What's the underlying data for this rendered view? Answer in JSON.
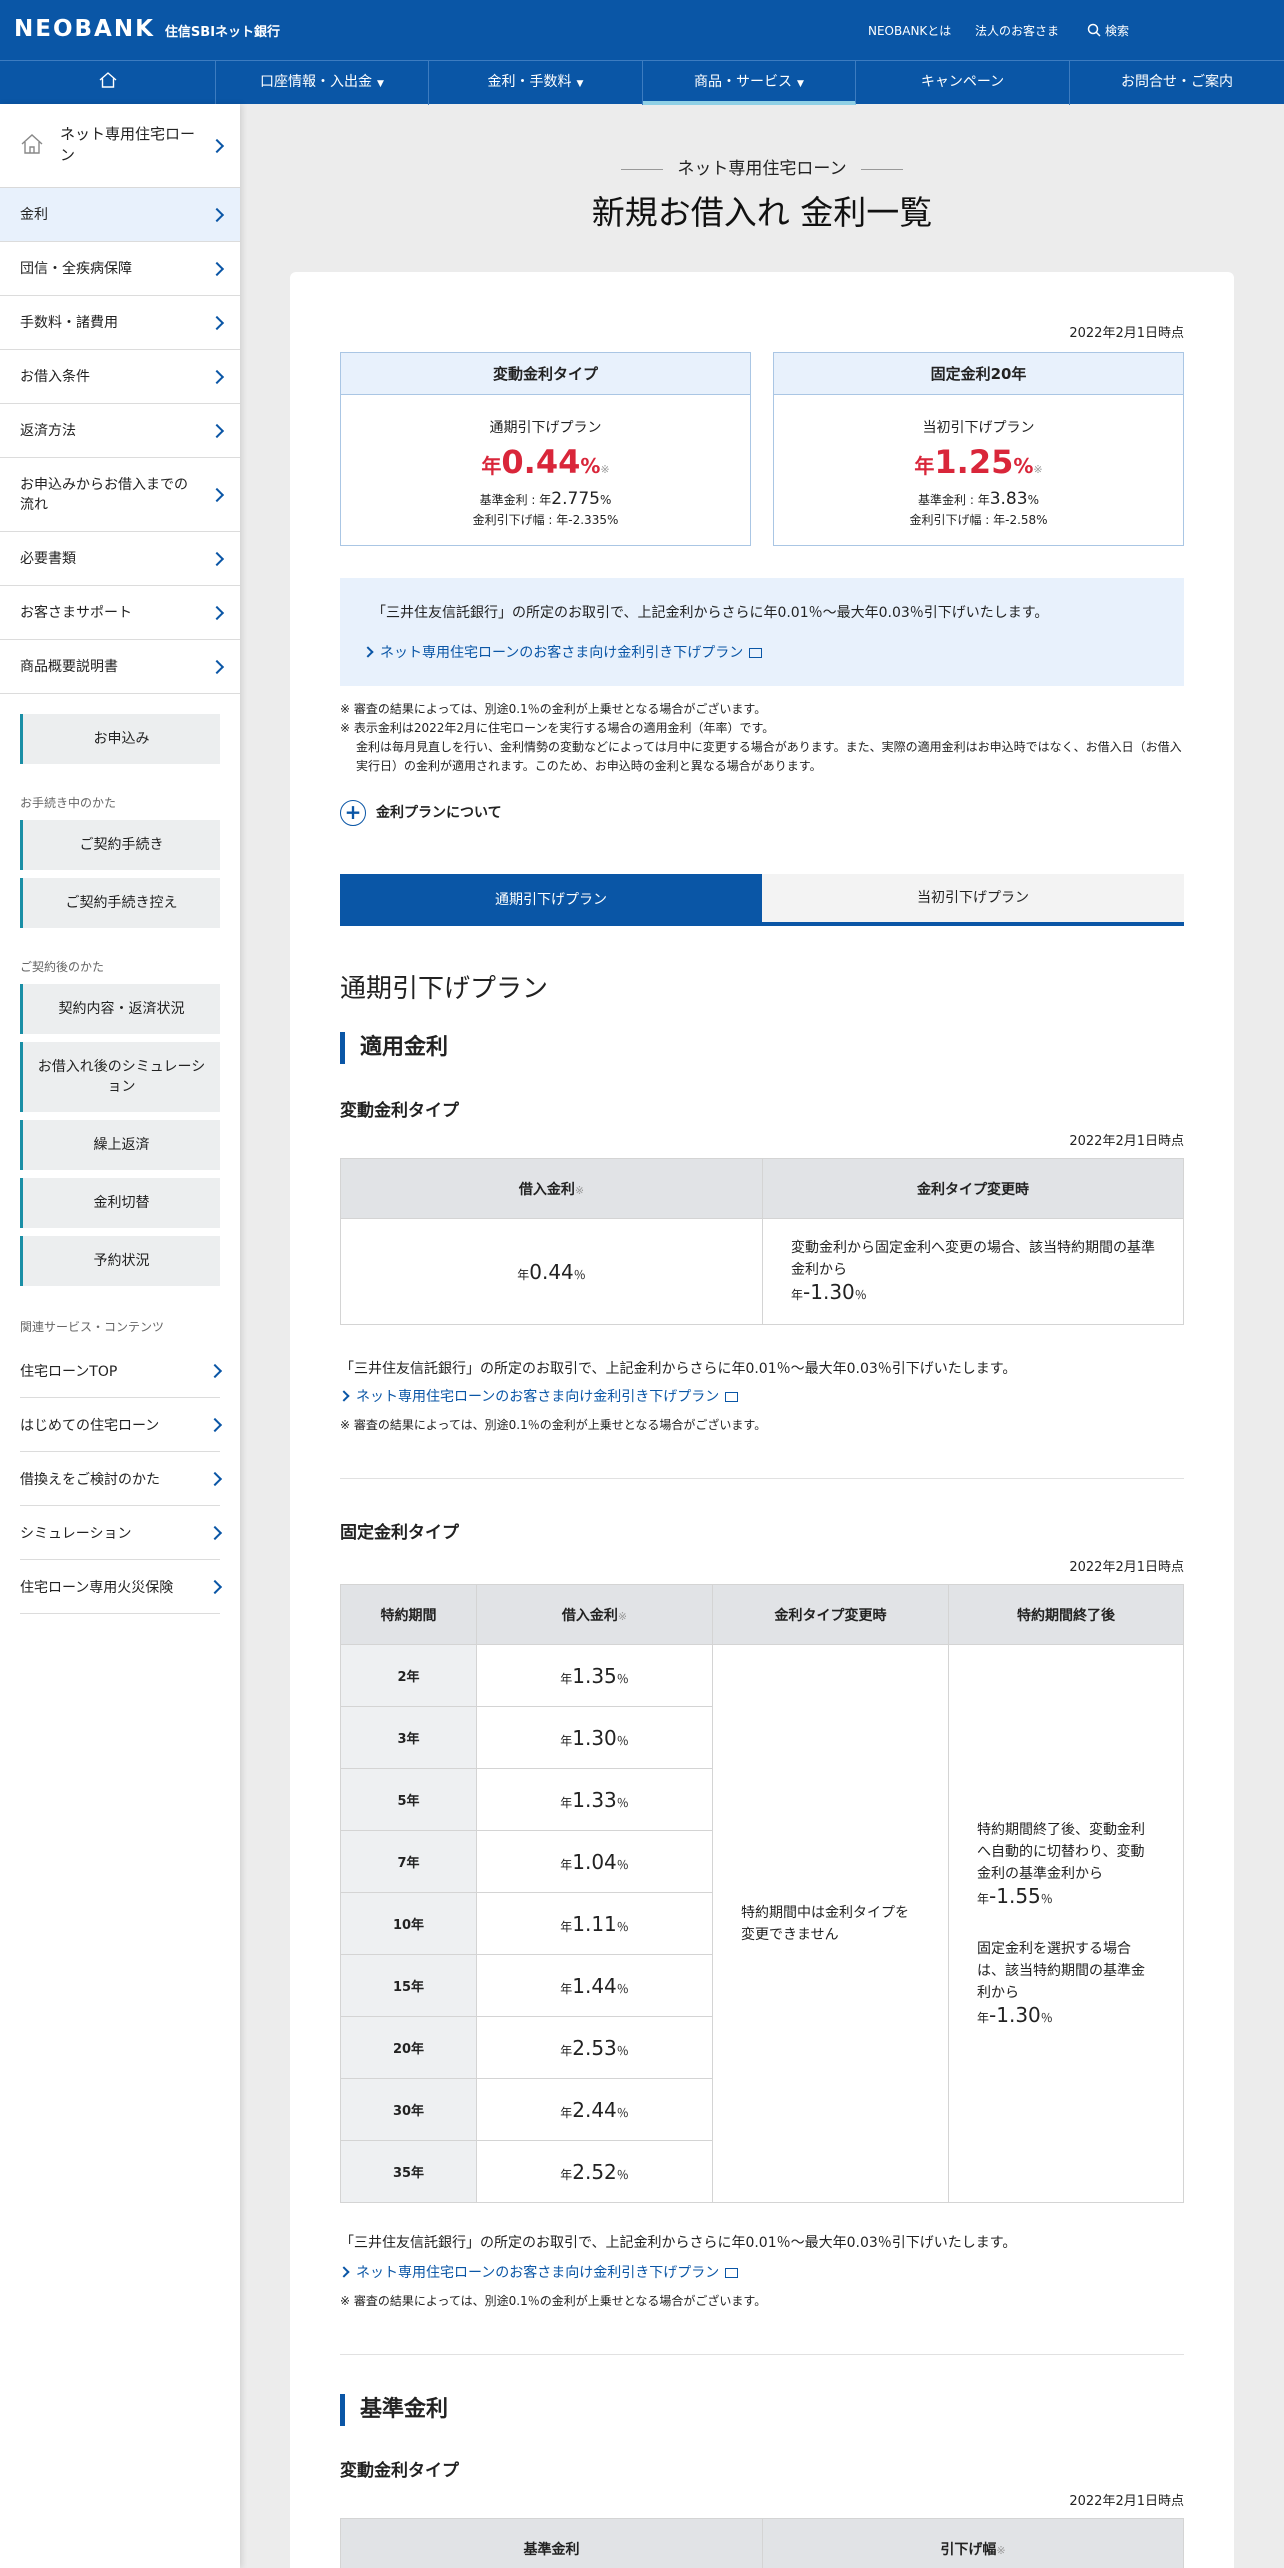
{
  "header": {
    "logo": "NEOBANK",
    "logo_sub": "住信SBIネット銀行",
    "links": [
      "NEOBANKとは",
      "法人のお客さま"
    ],
    "search": "検索"
  },
  "nav": {
    "items": [
      "口座情報・入出金",
      "金利・手数料",
      "商品・サービス",
      "キャンペーン",
      "お問合せ・ご案内"
    ],
    "active": "商品・サービス"
  },
  "sidebar": {
    "top": "ネット専用住宅ローン",
    "items": [
      "金利",
      "団信・全疾病保障",
      "手数料・諸費用",
      "お借入条件",
      "返済方法",
      "お申込みからお借入までの流れ",
      "必要書類",
      "お客さまサポート",
      "商品概要説明書"
    ],
    "apply": "お申込み",
    "group1": "お手続き中のかた",
    "group1_items": [
      "ご契約手続き",
      "ご契約手続き控え"
    ],
    "group2": "ご契約後のかた",
    "group2_items": [
      "契約内容・返済状況",
      "お借入れ後のシミュレーション",
      "繰上返済",
      "金利切替",
      "予約状況"
    ],
    "group3": "関連サービス・コンテンツ",
    "group3_items": [
      "住宅ローンTOP",
      "はじめての住宅ローン",
      "借換えをご検討のかた",
      "シミュレーション",
      "住宅ローン専用火災保険"
    ]
  },
  "page": {
    "eyebrow": "ネット専用住宅ローン",
    "title": "新規お借入れ 金利一覧"
  },
  "summary": {
    "date": "2022年2月1日時点",
    "boxes": [
      {
        "title": "変動金利タイプ",
        "plan": "通期引下げプラン",
        "prefix": "年",
        "rate": "0.44",
        "pct": "%",
        "mark": "※",
        "base_label": "基準金利 : 年",
        "base": "2.775",
        "base_pct": "%",
        "diff": "金利引下げ幅 : 年-2.335%"
      },
      {
        "title": "固定金利20年",
        "plan": "当初引下げプラン",
        "prefix": "年",
        "rate": "1.25",
        "pct": "%",
        "mark": "※",
        "base_label": "基準金利 : 年",
        "base": "3.83",
        "base_pct": "%",
        "diff": "金利引下げ幅 : 年-2.58%"
      }
    ]
  },
  "notebox": {
    "text": "「三井住友信託銀行」の所定のお取引で、上記金利からさらに年0.01％～最大年0.03％引下げいたします。",
    "link": "ネット専用住宅ローンのお客さま向け金利引き下げプラン"
  },
  "notes": [
    "※ 審査の結果によっては、別途0.1％の金利が上乗せとなる場合がございます。",
    "※ 表示金利は2022年2月に住宅ローンを実行する場合の適用金利（年率）です。",
    "金利は毎月見直しを行い、金利情勢の変動などによっては月中に変更する場合があります。また、実際の適用金利はお申込時ではなく、お借入日（お借入実行日）の金利が適用されます。このため、お申込時の金利と異なる場合があります。"
  ],
  "plan_about": "金利プランについて",
  "tabs": [
    "通期引下げプラン",
    "当初引下げプラン"
  ],
  "section": {
    "title": "通期引下げプラン",
    "applied": "適用金利",
    "var_title": "変動金利タイプ",
    "date": "2022年2月1日時点",
    "var_table": {
      "h1": "借入金利",
      "mark": "※",
      "h2": "金利タイプ変更時",
      "rate_pre": "年",
      "rate": "0.44",
      "rate_suf": "％",
      "change": "変動金利から固定金利へ変更の場合、該当特約期間の基準金利から",
      "change_pre": "年",
      "change_rate": "-1.30",
      "change_suf": "％"
    },
    "note_line": "「三井住友信託銀行」の所定のお取引で、上記金利からさらに年0.01％～最大年0.03％引下げいたします。",
    "link": "ネット専用住宅ローンのお客さま向け金利引き下げプラン",
    "note_small": "※ 審査の結果によっては、別途0.1％の金利が上乗せとなる場合がございます。",
    "fixed_title": "固定金利タイプ",
    "fixed_table": {
      "headers": [
        "特約期間",
        "借入金利",
        "金利タイプ変更時",
        "特約期間終了後"
      ],
      "rows": [
        {
          "term": "2年",
          "rate": "1.35"
        },
        {
          "term": "3年",
          "rate": "1.30"
        },
        {
          "term": "5年",
          "rate": "1.33"
        },
        {
          "term": "7年",
          "rate": "1.04"
        },
        {
          "term": "10年",
          "rate": "1.11"
        },
        {
          "term": "15年",
          "rate": "1.44"
        },
        {
          "term": "20年",
          "rate": "2.53"
        },
        {
          "term": "30年",
          "rate": "2.44"
        },
        {
          "term": "35年",
          "rate": "2.52"
        }
      ],
      "pre": "年",
      "suf": "％",
      "change": "特約期間中は金利タイプを変更できません",
      "end1": "特約期間終了後、変動金利へ自動的に切替わり、変動金利の基準金利から",
      "end1_rate": "-1.55",
      "end2": "固定金利を選択する場合は、該当特約期間の基準金利から",
      "end2_rate": "-1.30"
    },
    "base_title": "基準金利",
    "base_var_title": "変動金利タイプ",
    "base_headers": [
      "基準金利",
      "引下げ幅"
    ]
  }
}
